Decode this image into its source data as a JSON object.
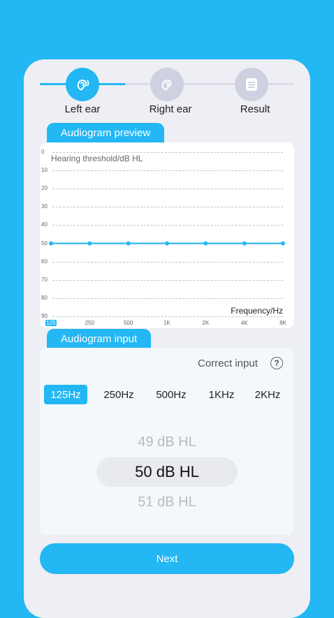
{
  "stepper": {
    "steps": [
      {
        "label": "Left ear",
        "icon": "ear-hearing-icon",
        "active": true
      },
      {
        "label": "Right ear",
        "icon": "ear-icon",
        "active": false
      },
      {
        "label": "Result",
        "icon": "document-icon",
        "active": false
      }
    ]
  },
  "preview": {
    "tab_label": "Audiogram preview"
  },
  "chart_data": {
    "type": "line",
    "title": "",
    "ylabel": "Hearing threshold/dB HL",
    "xlabel": "Frequency/Hz",
    "x": [
      "125",
      "250",
      "500",
      "1K",
      "2K",
      "4K",
      "8K"
    ],
    "yticks": [
      "0",
      "10",
      "20",
      "30",
      "40",
      "50",
      "60",
      "70",
      "80",
      "90"
    ],
    "ylim": [
      0,
      90
    ],
    "y_inverted": true,
    "grid": true,
    "series": [
      {
        "values": [
          50,
          50,
          50,
          50,
          50,
          50,
          50
        ],
        "color": "#23b7f3"
      }
    ],
    "highlighted_x": "125"
  },
  "input": {
    "tab_label": "Audiogram input",
    "correct_input_label": "Correct input",
    "help_icon": "question-circle-icon",
    "frequencies": [
      "125Hz",
      "250Hz",
      "500Hz",
      "1KHz",
      "2KHz"
    ],
    "selected_frequency": "125Hz",
    "picker": {
      "previous": "49 dB HL",
      "current": "50 dB HL",
      "next": "51 dB HL"
    }
  },
  "next_button": {
    "label": "Next"
  },
  "colors": {
    "accent": "#23b7f3",
    "inactive_step": "#cfd0e0",
    "background": "#eeeff5"
  }
}
